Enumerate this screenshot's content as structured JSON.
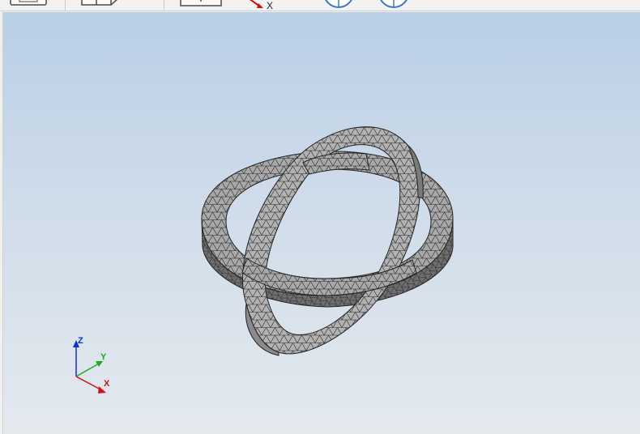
{
  "toolbar": {
    "items": [
      {
        "name": "window-icon"
      },
      {
        "name": "view-box-icon"
      },
      {
        "name": "view-down-icon"
      },
      {
        "name": "axis-x-view-icon",
        "label": "X"
      },
      {
        "name": "rotate-left-icon"
      },
      {
        "name": "rotate-right-icon"
      }
    ]
  },
  "triad": {
    "z": "Z",
    "y": "Y",
    "x": "X"
  },
  "colors": {
    "x_axis": "#d01010",
    "y_axis": "#22aa22",
    "z_axis": "#1030d0",
    "mesh_fill": "#a9a9a9",
    "mesh_edge": "#2a2a2a"
  }
}
